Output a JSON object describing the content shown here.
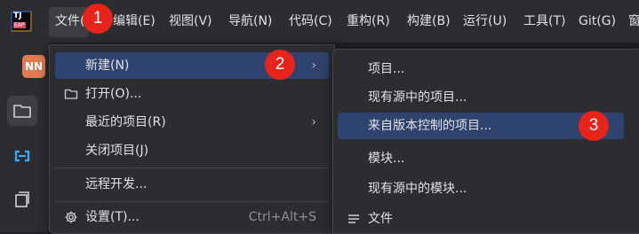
{
  "menubar": {
    "logo_text": "TJ",
    "logo_sub": "EAP",
    "items": [
      {
        "label": "文件(F)"
      },
      {
        "label": "编辑(E)"
      },
      {
        "label": "视图(V)"
      },
      {
        "label": "导航(N)"
      },
      {
        "label": "代码(C)"
      },
      {
        "label": "重构(R)"
      },
      {
        "label": "构建(B)"
      },
      {
        "label": "运行(U)"
      },
      {
        "label": "工具(T)"
      },
      {
        "label": "Git(G)"
      },
      {
        "label": "窗"
      }
    ]
  },
  "project": {
    "avatar": "NN"
  },
  "file_menu": {
    "items": [
      {
        "label": "新建(N)",
        "has_submenu": true,
        "icon": ""
      },
      {
        "label": "打开(O)...",
        "icon": "folder-icon"
      },
      {
        "label": "最近的项目(R)",
        "has_submenu": true
      },
      {
        "label": "关闭项目(J)"
      },
      {
        "label": "远程开发..."
      },
      {
        "label": "设置(T)...",
        "icon": "gear-icon",
        "shortcut": "Ctrl+Alt+S"
      }
    ]
  },
  "new_submenu": {
    "items": [
      {
        "label": "项目..."
      },
      {
        "label": "现有源中的项目..."
      },
      {
        "label": "来自版本控制的项目..."
      },
      {
        "label": "模块..."
      },
      {
        "label": "现有源中的模块..."
      },
      {
        "label": "文件",
        "icon": "text-file-icon"
      }
    ]
  },
  "annotations": {
    "step1": "1",
    "step2": "2",
    "step3": "3"
  },
  "colors": {
    "highlight": "#2e436e",
    "badge": "#e8231a",
    "avatar": "#e07b53"
  }
}
